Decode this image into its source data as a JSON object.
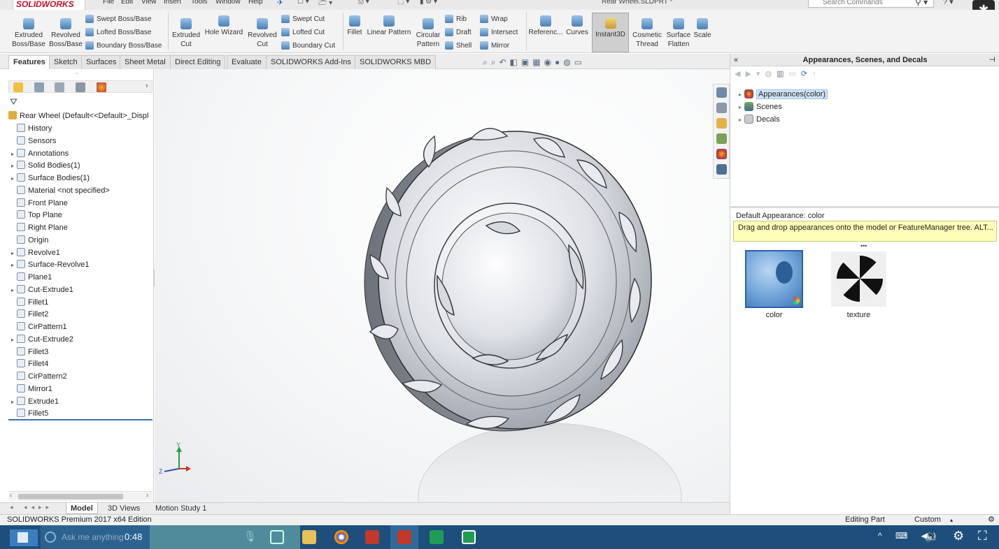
{
  "app": {
    "logo": "SOLIDWORKS",
    "document_title": "Rear Wheel.SLDPRT *",
    "search_placeholder": "Search Commands"
  },
  "menu": [
    "File",
    "Edit",
    "View",
    "Insert",
    "Tools",
    "Window",
    "Help"
  ],
  "commands": {
    "extruded_boss": "Extruded Boss/Base",
    "revolved_boss": "Revolved Boss/Base",
    "swept_boss": "Swept Boss/Base",
    "lofted_boss": "Lofted Boss/Base",
    "boundary_boss": "Boundary Boss/Base",
    "extruded_cut": "Extruded Cut",
    "hole_wizard": "Hole Wizard",
    "revolved_cut": "Revolved Cut",
    "swept_cut": "Swept Cut",
    "lofted_cut": "Lofted Cut",
    "boundary_cut": "Boundary Cut",
    "fillet": "Fillet",
    "linear_pattern": "Linear Pattern",
    "circular_pattern": "Circular Pattern",
    "rib": "Rib",
    "draft": "Draft",
    "shell": "Shell",
    "wrap": "Wrap",
    "intersect": "Intersect",
    "mirror": "Mirror",
    "reference": "Referenc...",
    "curves": "Curves",
    "instant3d": "Instant3D",
    "cosmetic_thread": "Cosmetic Thread",
    "surface_flatten": "Surface Flatten",
    "scale": "Scale"
  },
  "tabs": [
    "Features",
    "Sketch",
    "Surfaces",
    "Sheet Metal",
    "Direct Editing",
    "Evaluate",
    "SOLIDWORKS Add-Ins",
    "SOLIDWORKS MBD"
  ],
  "active_tab": "Features",
  "feature_tree": {
    "root": "Rear Wheel  (Default<<Default>_Displ",
    "items": [
      {
        "label": "History",
        "expandable": false
      },
      {
        "label": "Sensors",
        "expandable": false
      },
      {
        "label": "Annotations",
        "expandable": true
      },
      {
        "label": "Solid Bodies(1)",
        "expandable": true
      },
      {
        "label": "Surface Bodies(1)",
        "expandable": true
      },
      {
        "label": "Material <not specified>",
        "expandable": false
      },
      {
        "label": "Front Plane",
        "expandable": false
      },
      {
        "label": "Top Plane",
        "expandable": false
      },
      {
        "label": "Right Plane",
        "expandable": false
      },
      {
        "label": "Origin",
        "expandable": false
      },
      {
        "label": "Revolve1",
        "expandable": true
      },
      {
        "label": "Surface-Revolve1",
        "expandable": true
      },
      {
        "label": "Plane1",
        "expandable": false
      },
      {
        "label": "Cut-Extrude1",
        "expandable": true
      },
      {
        "label": "Fillet1",
        "expandable": false
      },
      {
        "label": "Fillet2",
        "expandable": false
      },
      {
        "label": "CirPattern1",
        "expandable": false
      },
      {
        "label": "Cut-Extrude2",
        "expandable": true
      },
      {
        "label": "Fillet3",
        "expandable": false
      },
      {
        "label": "Fillet4",
        "expandable": false
      },
      {
        "label": "CirPattern2",
        "expandable": false
      },
      {
        "label": "Mirror1",
        "expandable": false
      },
      {
        "label": "Extrude1",
        "expandable": true
      },
      {
        "label": "Fillet5",
        "expandable": false
      }
    ]
  },
  "bottom_tabs": [
    "Model",
    "3D Views",
    "Motion Study 1"
  ],
  "status": {
    "edition": "SOLIDWORKS Premium 2017 x64 Edition",
    "mode": "Editing Part",
    "units": "Custom"
  },
  "task_pane": {
    "title": "Appearances, Scenes, and Decals",
    "tree": [
      "Appearances(color)",
      "Scenes",
      "Decals"
    ],
    "default_label": "Default Appearance: color",
    "tooltip": "Drag and drop appearances onto the model or FeatureManager tree.  ALT...",
    "swatches": [
      "color",
      "texture"
    ]
  },
  "taskbar": {
    "search_placeholder": "Ask me anything",
    "timer": "0:48"
  },
  "axis_labels": {
    "y": "Y",
    "z": "Z"
  }
}
